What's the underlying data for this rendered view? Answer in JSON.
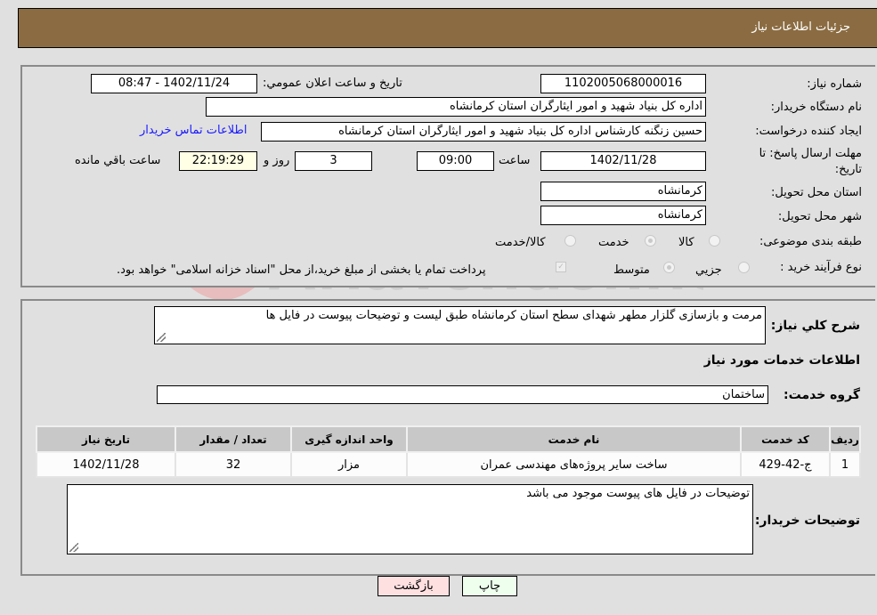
{
  "header": {
    "title": "جزئیات اطلاعات نیاز"
  },
  "fields": {
    "need_number_label": "شماره نیاز:",
    "need_number": "1102005068000016",
    "announce_label": "تاریخ و ساعت اعلان عمومي:",
    "announce_value": "1402/11/24 - 08:47",
    "buyer_org_label": "نام دستگاه خریدار:",
    "buyer_org": "اداره کل بنیاد شهید و امور ایثارگران استان کرمانشاه",
    "creator_label": "ایجاد کننده درخواست:",
    "creator": "حسین زنگنه کارشناس اداره کل بنیاد شهید و امور ایثارگران استان کرمانشاه",
    "buyer_contact_link": "اطلاعات تماس خریدار",
    "deadline_label_1": "مهلت ارسال پاسخ: تا",
    "deadline_label_2": "تاریخ:",
    "deadline_date": "1402/11/28",
    "time_label": "ساعت",
    "deadline_time": "09:00",
    "days_value": "3",
    "days_label": "روز و",
    "remaining_value": "22:19:29",
    "remaining_label": "ساعت باقي مانده",
    "province_label": "استان محل تحویل:",
    "province": "کرمانشاه",
    "city_label": "شهر محل تحویل:",
    "city": "کرمانشاه",
    "category_label": "طبقه بندی موضوعی:",
    "category_options": [
      {
        "label": "کالا",
        "checked": false
      },
      {
        "label": "خدمت",
        "checked": true
      },
      {
        "label": "کالا/خدمت",
        "checked": false
      }
    ],
    "process_label": "نوع فرآیند خرید :",
    "process_options": [
      {
        "label": "جزيي",
        "checked": false
      },
      {
        "label": "متوسط",
        "checked": true
      }
    ],
    "treasury_note": "پرداخت تمام یا بخشی از مبلغ خرید،از محل \"اسناد خزانه اسلامی\" خواهد بود.",
    "treasury_checked": true
  },
  "details": {
    "summary_label": "شرح کلي نياز:",
    "summary": "مرمت و بازسازی گلزار مطهر شهدای سطح استان کرمانشاه طبق لیست و توضیحات پیوست در فایل ها",
    "services_heading": "اطلاعات خدمات مورد نیاز",
    "service_group_label": "گروه خدمت:",
    "service_group": "ساختمان",
    "table": {
      "headers": [
        "ردیف",
        "کد خدمت",
        "نام خدمت",
        "واحد اندازه گیری",
        "تعداد / مقدار",
        "تاریخ نیاز"
      ],
      "rows": [
        [
          "1",
          "ج-42-429",
          "ساخت سایر پروژه‌های مهندسی عمران",
          "مزار",
          "32",
          "1402/11/28"
        ]
      ]
    },
    "buyer_notes_label": "توضیحات خریدار:",
    "buyer_notes": "توضیحات در فایل های پیوست موجود می باشد"
  },
  "buttons": {
    "print": "چاپ",
    "back": "بازگشت"
  },
  "watermark": {
    "text": "AriaTender.neT"
  }
}
